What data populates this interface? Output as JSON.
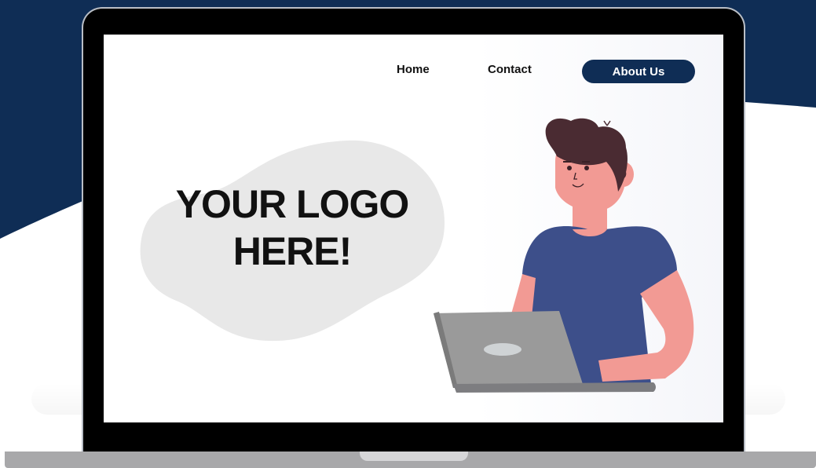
{
  "nav": {
    "home_label": "Home",
    "contact_label": "Contact",
    "about_label": "About Us"
  },
  "hero": {
    "logo_line1": "YOUR LOGO",
    "logo_line2": "HERE!"
  },
  "colors": {
    "navy": "#0f2d55",
    "blob": "#e8e8e8",
    "shirt": "#3d4f8a",
    "skin": "#f29a94",
    "hair": "#4a2b32",
    "laptop": "#9a9a9a"
  }
}
